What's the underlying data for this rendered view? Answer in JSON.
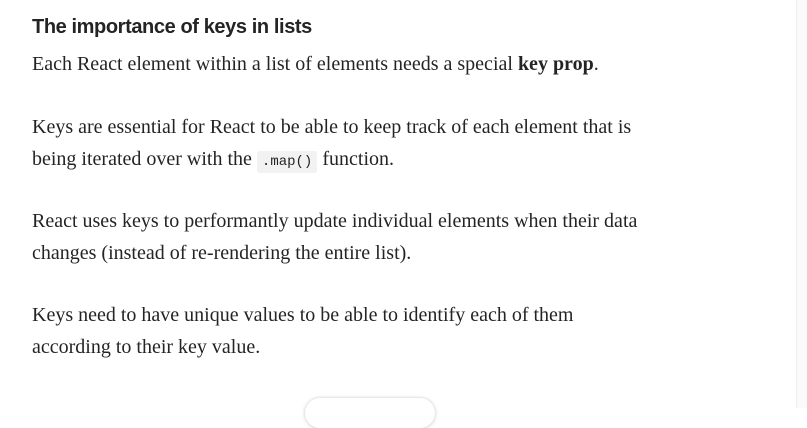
{
  "article": {
    "heading": "The importance of keys in lists",
    "p1": {
      "text": "Each React element within a list of elements needs a special ",
      "bold": "key prop",
      "end": "."
    },
    "p2": {
      "line1": "Keys are essential for React to be able to keep track of each element that is",
      "line2_start": "being iterated over with the ",
      "code": ".map()",
      "line2_end": " function."
    },
    "p3": {
      "line1": "React uses keys to performantly update individual elements when their data",
      "line2": "changes (instead of re-rendering the entire list)."
    },
    "p4": {
      "line1": "Keys need to have unique values to be able to identify each of them",
      "line2": "according to their key value."
    }
  }
}
